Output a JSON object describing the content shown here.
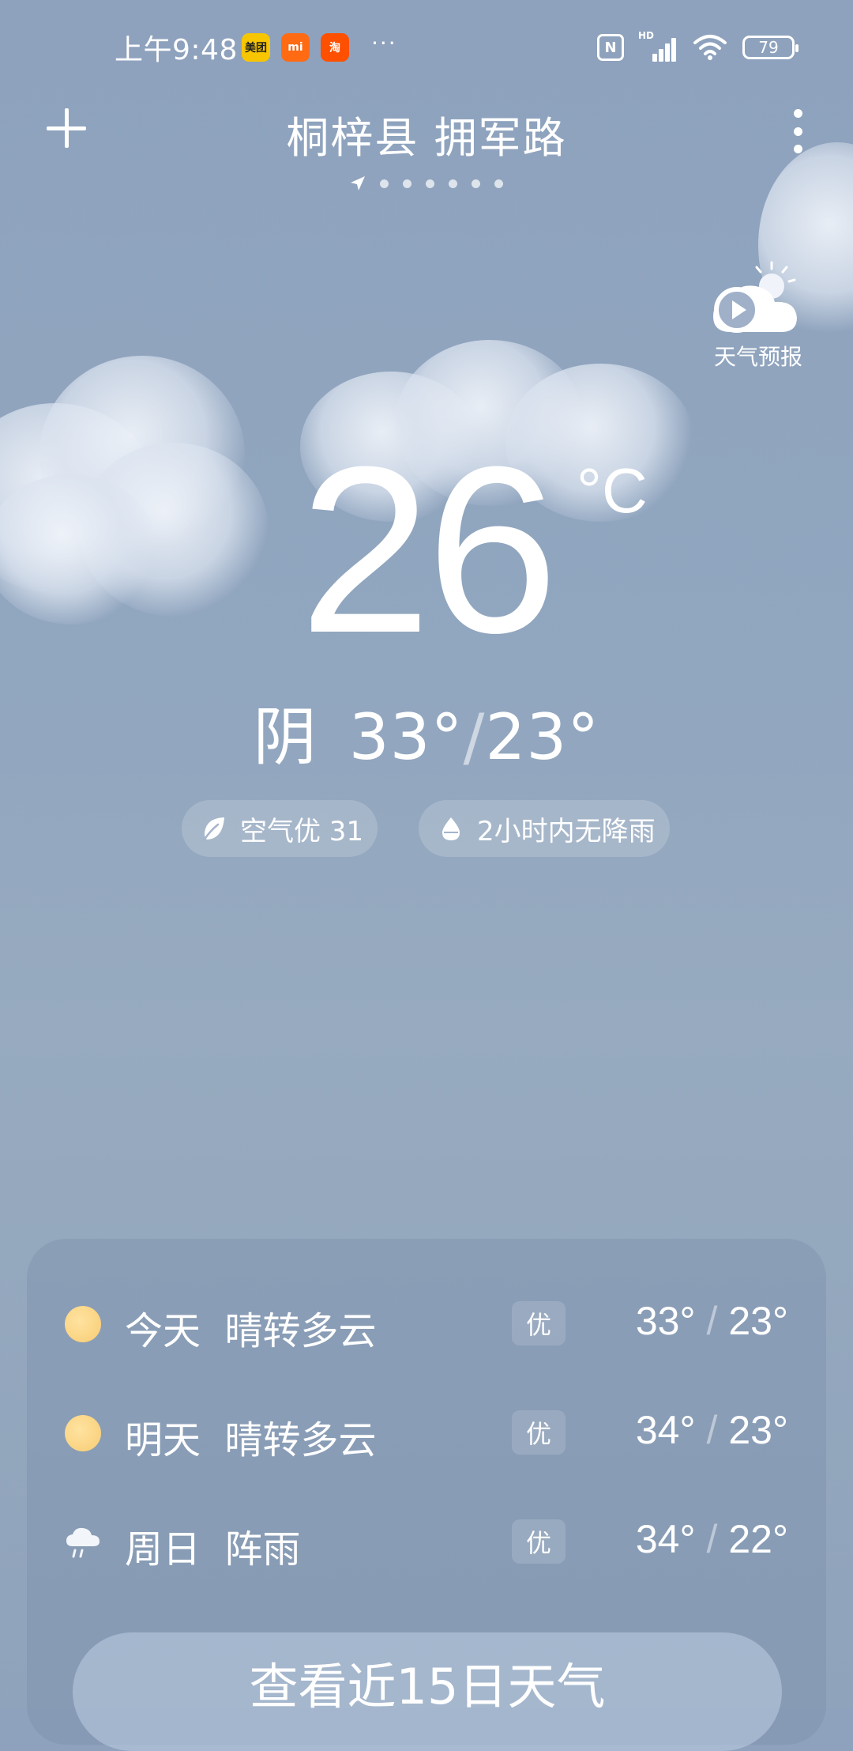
{
  "status_bar": {
    "time": "上午9:48",
    "apps": [
      {
        "name": "meituan",
        "label": "美团"
      },
      {
        "name": "mi",
        "label": "mi"
      },
      {
        "name": "taobao",
        "label": "淘"
      }
    ],
    "more": "···",
    "nfc": "N",
    "network": "HD",
    "battery": "79"
  },
  "header": {
    "location": "桐梓县 拥军路",
    "page_count": 7,
    "current_page": 0
  },
  "forecast_video": {
    "label": "天气预报"
  },
  "current": {
    "temperature": "26",
    "unit": "°C",
    "condition": "阴",
    "high": "33°",
    "low": "23°",
    "separator": "/"
  },
  "pills": {
    "air_quality": "空气优 31",
    "rain": "2小时内无降雨"
  },
  "forecast": {
    "rows": [
      {
        "day": "今天",
        "condition": "晴转多云",
        "aqi": "优",
        "high": "33°",
        "low": "23°",
        "icon": "sun-icon"
      },
      {
        "day": "明天",
        "condition": "晴转多云",
        "aqi": "优",
        "high": "34°",
        "low": "23°",
        "icon": "sun-icon"
      },
      {
        "day": "周日",
        "condition": "阵雨",
        "aqi": "优",
        "high": "34°",
        "low": "22°",
        "icon": "rain-cloud-icon"
      }
    ],
    "button_label": "查看近15日天气"
  },
  "colors": {
    "background_top": "#8ea2bd",
    "sun": "#f8cc74"
  }
}
